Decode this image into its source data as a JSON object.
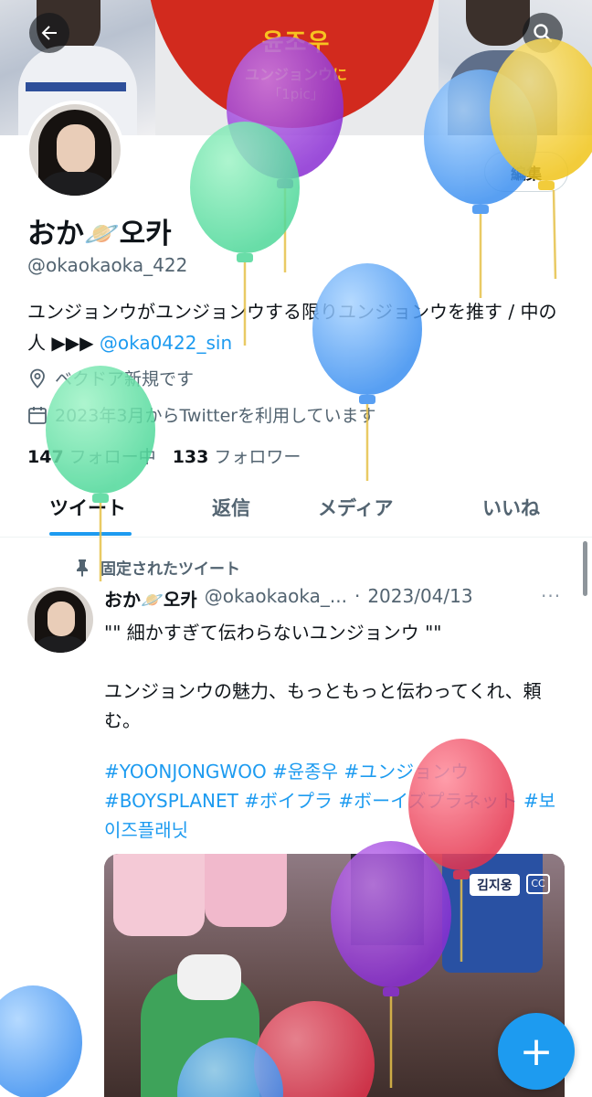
{
  "banner": {
    "title": "윤조우",
    "subtitle": "ユンジョンウに",
    "subtitle2": "「1pic」"
  },
  "nav": {
    "back_icon": "arrow-left-icon",
    "search_icon": "search-icon"
  },
  "profile": {
    "edit_label": "編集",
    "display_name": "おか🪐오카",
    "username": "@okaokaoka_422",
    "bio_text": "ユンジョンウがユンジョンウする限りユンジョンウを推す / 中の人 ▶▶▶ ",
    "bio_link": "@oka0422_sin",
    "location": "ベクドア新規です",
    "joined": "2023年3月からTwitterを利用しています",
    "following_count": "147",
    "following_label": "フォロー中",
    "followers_count": "133",
    "followers_label": "フォロワー"
  },
  "tabs": [
    {
      "label": "ツイート",
      "active": true
    },
    {
      "label": "返信",
      "active": false
    },
    {
      "label": "メディア",
      "active": false
    },
    {
      "label": "いいね",
      "active": false
    }
  ],
  "tweet": {
    "pinned_label": "固定されたツイート",
    "name": "おか🪐오카",
    "handle": "@okaokaoka_...",
    "separator": "·",
    "date": "2023/04/13",
    "more": "···",
    "text": "\"\" 細かすぎて伝わらないユンジョンウ \"\"\n\nユンジョンウの魅力、もっともっと伝わってくれ、頼む。",
    "hashtags": "#YOONJONGWOO #윤종우 #ユンジョンウ #BOYSPLANET #ボイプラ #ボーイズプラネット #보이즈플래닛",
    "media_badge": "김지웅"
  },
  "fab": {
    "label": "+"
  },
  "colors": {
    "accent": "#1d9bf0",
    "banner_red": "#d22a1e",
    "banner_text": "#f7c321"
  }
}
